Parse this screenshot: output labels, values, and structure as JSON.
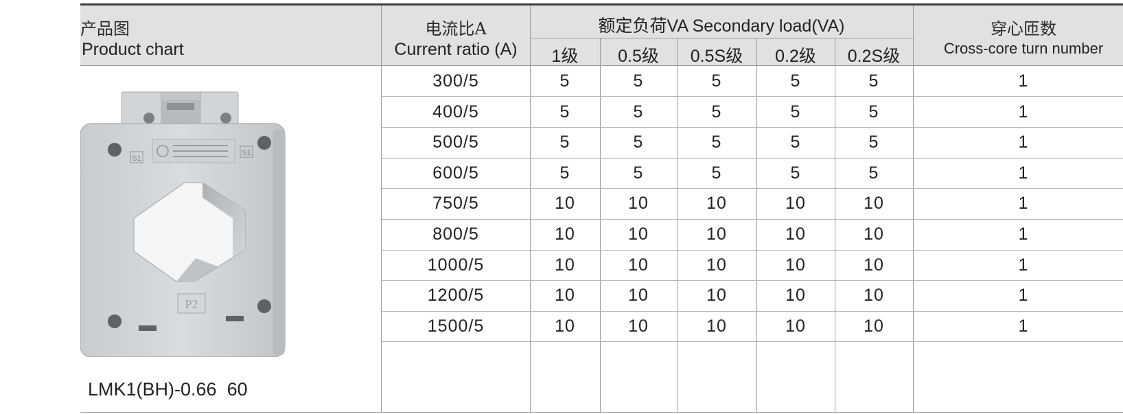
{
  "header": {
    "product_cn": "产品图",
    "product_en": "Product chart",
    "ratio_cn": "电流比A",
    "ratio_en": "Current ratio (A)",
    "load_group": "额定负荷VA Secondary load(VA)",
    "classes": [
      "1级",
      "0.5级",
      "0.5S级",
      "0.2级",
      "0.2S级"
    ],
    "turns_cn": "穿心匝数",
    "turns_en": "Cross-core turn number"
  },
  "rows": [
    {
      "ratio": "300/5",
      "loads": [
        "5",
        "5",
        "5",
        "5",
        "5"
      ],
      "turns": "1"
    },
    {
      "ratio": "400/5",
      "loads": [
        "5",
        "5",
        "5",
        "5",
        "5"
      ],
      "turns": "1"
    },
    {
      "ratio": "500/5",
      "loads": [
        "5",
        "5",
        "5",
        "5",
        "5"
      ],
      "turns": "1"
    },
    {
      "ratio": "600/5",
      "loads": [
        "5",
        "5",
        "5",
        "5",
        "5"
      ],
      "turns": "1"
    },
    {
      "ratio": "750/5",
      "loads": [
        "10",
        "10",
        "10",
        "10",
        "10"
      ],
      "turns": "1"
    },
    {
      "ratio": "800/5",
      "loads": [
        "10",
        "10",
        "10",
        "10",
        "10"
      ],
      "turns": "1"
    },
    {
      "ratio": "1000/5",
      "loads": [
        "10",
        "10",
        "10",
        "10",
        "10"
      ],
      "turns": "1"
    },
    {
      "ratio": "1200/5",
      "loads": [
        "10",
        "10",
        "10",
        "10",
        "10"
      ],
      "turns": "1"
    },
    {
      "ratio": "1500/5",
      "loads": [
        "10",
        "10",
        "10",
        "10",
        "10"
      ],
      "turns": "1"
    }
  ],
  "product": {
    "model": "LMK1(BH)-0.66  60",
    "terminal_left": "S1",
    "terminal_right": "S1",
    "marking": "P2"
  },
  "colors": {
    "header_bg": "#dfe1e3",
    "rule": "#3a3a3a",
    "grid": "#9a9a9a",
    "body_plastic": "#cfd2d4"
  }
}
